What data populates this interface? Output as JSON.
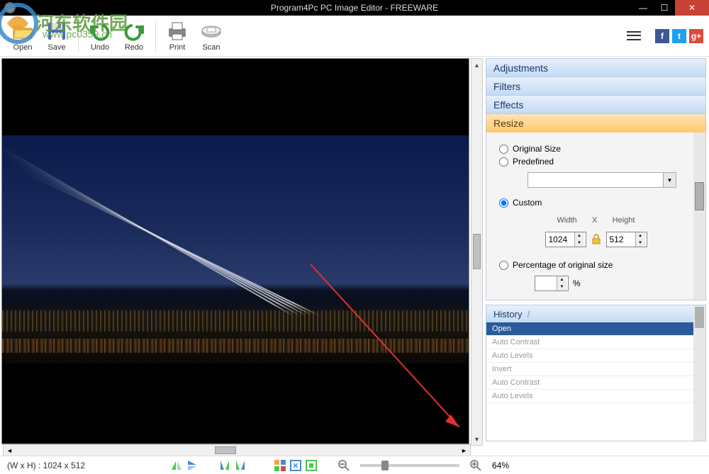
{
  "window": {
    "title": "Program4Pc PC Image Editor - FREEWARE"
  },
  "toolbar": {
    "open": "Open",
    "save": "Save",
    "undo": "Undo",
    "redo": "Redo",
    "print": "Print",
    "scan": "Scan"
  },
  "panels": {
    "adjustments": "Adjustments",
    "filters": "Filters",
    "effects": "Effects",
    "resize": "Resize"
  },
  "resize": {
    "original_size": "Original Size",
    "predefined": "Predefined",
    "custom": "Custom",
    "width_label": "Width",
    "x_label": "X",
    "height_label": "Height",
    "width_value": "1024",
    "height_value": "512",
    "percentage": "Percentage of original size",
    "percent_symbol": "%"
  },
  "history": {
    "title": "History",
    "sep": "/",
    "items": [
      {
        "label": "Open",
        "active": true
      },
      {
        "label": "Auto Contrast",
        "active": false
      },
      {
        "label": "Auto Levels",
        "active": false
      },
      {
        "label": "Invert",
        "active": false
      },
      {
        "label": "Auto Contrast",
        "active": false
      },
      {
        "label": "Auto Levels",
        "active": false
      }
    ]
  },
  "status": {
    "dimensions": "(W x H) : 1024 x 512",
    "zoom": "64%"
  },
  "watermark": {
    "line1": "河东软件园",
    "line2": "www.pc0359.cn"
  }
}
